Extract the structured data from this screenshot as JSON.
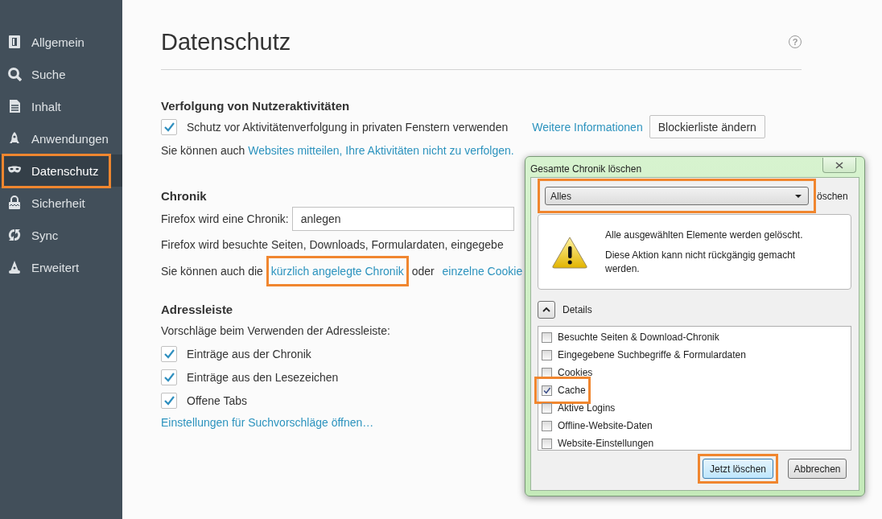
{
  "sidebar": {
    "items": [
      {
        "label": "Allgemein",
        "selected": false,
        "highlighted": false
      },
      {
        "label": "Suche",
        "selected": false,
        "highlighted": false
      },
      {
        "label": "Inhalt",
        "selected": false,
        "highlighted": false
      },
      {
        "label": "Anwendungen",
        "selected": false,
        "highlighted": false
      },
      {
        "label": "Datenschutz",
        "selected": true,
        "highlighted": true
      },
      {
        "label": "Sicherheit",
        "selected": false,
        "highlighted": false
      },
      {
        "label": "Sync",
        "selected": false,
        "highlighted": false
      },
      {
        "label": "Erweitert",
        "selected": false,
        "highlighted": false
      }
    ]
  },
  "page": {
    "title": "Datenschutz",
    "help": "?",
    "tracking": {
      "heading": "Verfolgung von Nutzeraktivitäten",
      "checkbox": {
        "label": "Schutz vor Aktivitätenverfolgung in privaten Fenstern verwenden",
        "checked": true
      },
      "more_link": "Weitere Informationen",
      "button": "Blockierliste ändern",
      "note": [
        {
          "text": "Sie können auch "
        },
        {
          "link": "Websites mitteilen, Ihre Aktivitäten nicht zu verfolgen."
        }
      ]
    },
    "history": {
      "heading": "Chronik",
      "select_label": "Firefox wird eine Chronik:",
      "select_value": "anlegen",
      "description": "Firefox wird besuchte Seiten, Downloads, Formulardaten, eingegebe",
      "note": [
        {
          "text": "Sie können auch die "
        },
        {
          "link": "kürzlich angelegte Chronik",
          "highlighted": true
        },
        {
          "text": " oder "
        },
        {
          "link": "einzelne Cookie",
          "highlighted": false
        }
      ]
    },
    "address_bar": {
      "heading": "Adressleiste",
      "intro": "Vorschläge beim Verwenden der Adressleiste:",
      "options": [
        {
          "label": "Einträge aus der Chronik",
          "checked": true
        },
        {
          "label": "Einträge aus den Lesezeichen",
          "checked": true
        },
        {
          "label": "Offene Tabs",
          "checked": true
        }
      ],
      "link": "Einstellungen für Suchvorschläge öffnen…"
    }
  },
  "dialog": {
    "title": "Gesamte Chronik löschen",
    "range": {
      "value": "Alles",
      "highlighted": true
    },
    "range_suffix": "öschen",
    "warning": [
      "Alle ausgewählten Elemente werden gelöscht.",
      "Diese Aktion kann nicht rückgängig gemacht werden."
    ],
    "details": {
      "label": "Details",
      "expanded": true
    },
    "items": [
      {
        "label": "Besuchte Seiten & Download-Chronik",
        "checked": false,
        "highlighted": false
      },
      {
        "label": "Eingegebene Suchbegriffe & Formulardaten",
        "checked": false,
        "highlighted": false
      },
      {
        "label": "Cookies",
        "checked": false,
        "highlighted": false
      },
      {
        "label": "Cache",
        "checked": true,
        "highlighted": true
      },
      {
        "label": "Aktive Logins",
        "checked": false,
        "highlighted": false
      },
      {
        "label": "Offline-Website-Daten",
        "checked": false,
        "highlighted": false
      },
      {
        "label": "Website-Einstellungen",
        "checked": false,
        "highlighted": false
      }
    ],
    "buttons": [
      {
        "label": "Jetzt löschen",
        "default": true,
        "highlighted": true
      },
      {
        "label": "Abbrechen",
        "default": false,
        "highlighted": false
      }
    ]
  }
}
